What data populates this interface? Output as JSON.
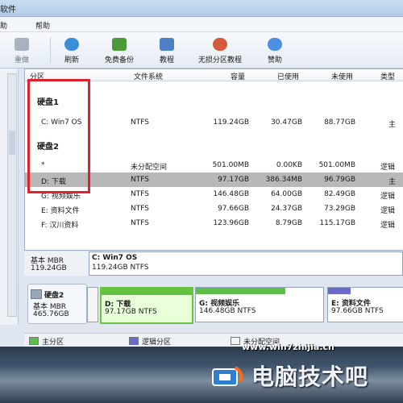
{
  "window": {
    "title_fragment": "软件"
  },
  "menu": {
    "item_left_fragment": "助",
    "help": "帮助"
  },
  "toolbar": {
    "undo": "重做",
    "refresh": "刷新",
    "free_backup": "免费备份",
    "tutorial": "教程",
    "lossless_tutorial": "无损分区教程",
    "sponsor": "赞助"
  },
  "table": {
    "headers": {
      "partition": "分区",
      "filesystem": "文件系统",
      "capacity": "容量",
      "used": "已使用",
      "unused": "未使用",
      "type": "类型"
    },
    "disk1_label": "硬盘1",
    "disk2_label": "硬盘2",
    "rows": [
      {
        "name": "C: Win7 OS",
        "fs": "NTFS",
        "cap": "119.24GB",
        "used": "30.47GB",
        "free": "88.77GB",
        "type": "主"
      },
      {
        "name": "*",
        "fs": "未分配空间",
        "cap": "501.00MB",
        "used": "0.00KB",
        "free": "501.00MB",
        "type": "逻辑"
      },
      {
        "name": "D: 下载",
        "fs": "NTFS",
        "cap": "97.17GB",
        "used": "386.34MB",
        "free": "96.79GB",
        "type": "主"
      },
      {
        "name": "G: 视频娱乐",
        "fs": "NTFS",
        "cap": "146.48GB",
        "used": "64.00GB",
        "free": "82.49GB",
        "type": "逻辑"
      },
      {
        "name": "E: 资料文件",
        "fs": "NTFS",
        "cap": "97.66GB",
        "used": "24.37GB",
        "free": "73.29GB",
        "type": "逻辑"
      },
      {
        "name": "F: 汉川资料",
        "fs": "NTFS",
        "cap": "123.96GB",
        "used": "8.79GB",
        "free": "115.17GB",
        "type": "逻辑"
      }
    ]
  },
  "map1": {
    "disk_type": "基本 MBR",
    "disk_size": "119.24GB",
    "part_name": "C: Win7 OS",
    "part_info": "119.24GB NTFS"
  },
  "map2": {
    "disk_label": "硬盘2",
    "disk_type": "基本 MBR",
    "disk_size": "465.76GB",
    "parts": [
      {
        "name": "D: 下载",
        "info": "97.17GB NTFS"
      },
      {
        "name": "G: 视频娱乐",
        "info": "146.48GB NTFS"
      },
      {
        "name": "E: 资料文件",
        "info": "97.66GB NTFS"
      }
    ]
  },
  "legend": {
    "primary": "主分区",
    "logical": "逻辑分区",
    "unallocated": "未分配空间"
  },
  "colors": {
    "primary": "#5cbf4a",
    "logical": "#6a6acb",
    "highlight": "#e0202a",
    "selected_row": "#b8b8b8"
  },
  "watermark": {
    "url": "www.win7zhijia.cn",
    "brand": "电脑技术吧"
  }
}
